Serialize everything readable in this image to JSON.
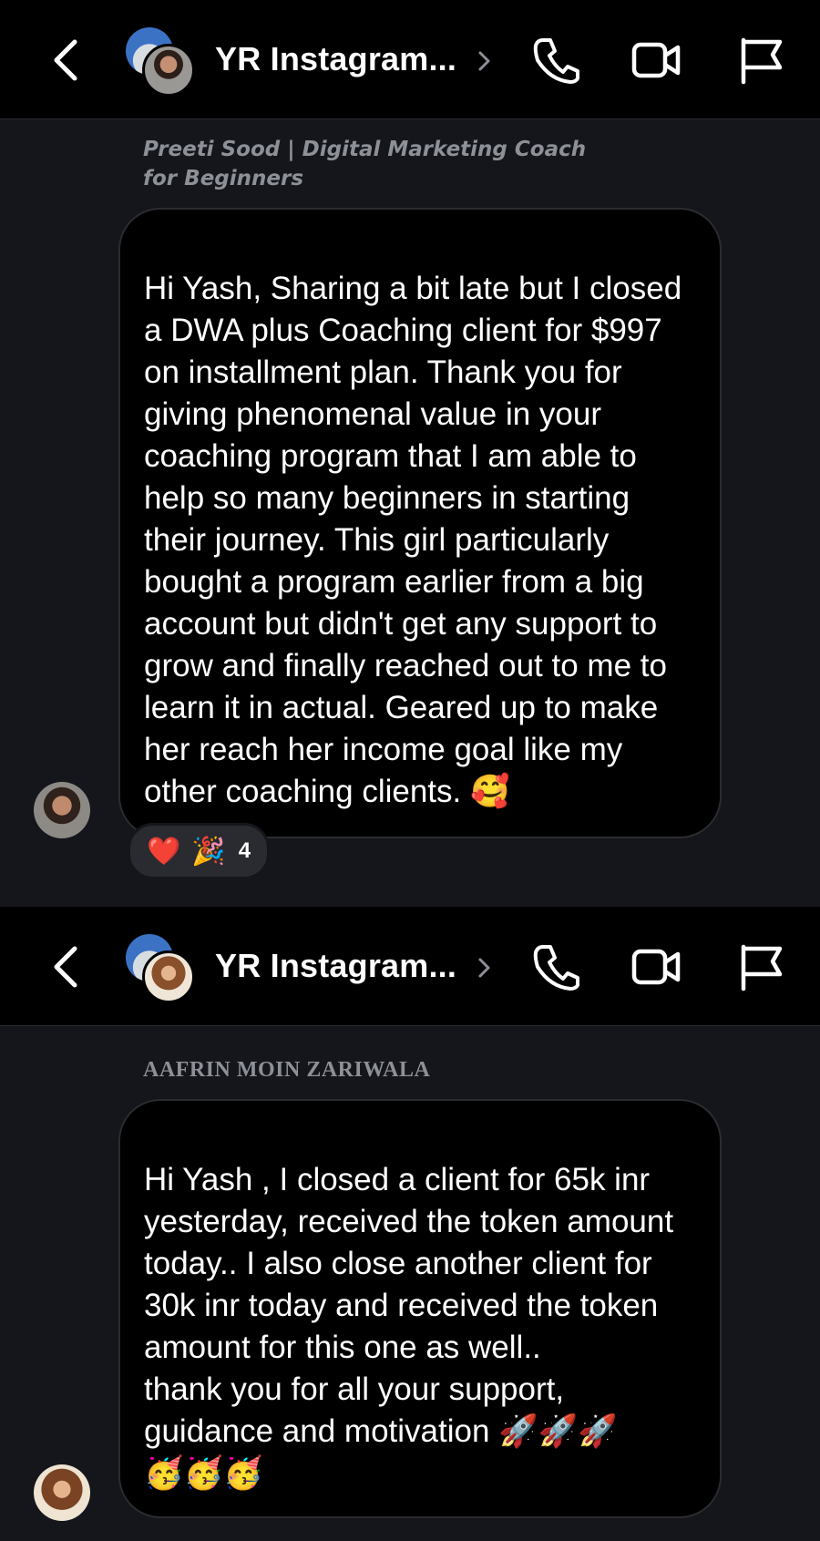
{
  "conversations": [
    {
      "header": {
        "title": "YR Instagram...",
        "icons": [
          "back-chevron-icon",
          "chevron-right-icon",
          "phone-icon",
          "video-camera-icon",
          "flag-icon"
        ]
      },
      "sender": "Preeti Sood | Digital Marketing Coach for Beginners",
      "message": "Hi Yash, Sharing a bit late but I closed a DWA plus Coaching client for $997 on installment plan. Thank you for giving phenomenal value in your coaching program that I am able to help so many beginners in starting their journey. This girl particularly bought a program earlier from a big account but didn't get any support to grow and finally reached out to me to learn it in actual. Geared up to make her reach her income goal like my other coaching clients. 🥰",
      "reactions": {
        "emojis": [
          "❤️",
          "🎉"
        ],
        "count": "4"
      }
    },
    {
      "header": {
        "title": "YR Instagram...",
        "icons": [
          "back-chevron-icon",
          "chevron-right-icon",
          "phone-icon",
          "video-camera-icon",
          "flag-icon"
        ]
      },
      "sender": "AAFRIN MOIN ZARIWALA",
      "message": "Hi Yash , I closed a client for 65k inr yesterday, received the token amount today.. I also close another client for 30k inr today and received the token amount for this one as well..\nthank you for all your support, guidance and motivation 🚀🚀🚀\n🥳🥳🥳"
    }
  ],
  "colors": {
    "background": "#14161b",
    "header_bg": "#000000",
    "bubble_bg": "#000000",
    "bubble_border": "#2b2c30",
    "sender_text": "#8d9097",
    "reaction_pill": "#2a2b30"
  }
}
